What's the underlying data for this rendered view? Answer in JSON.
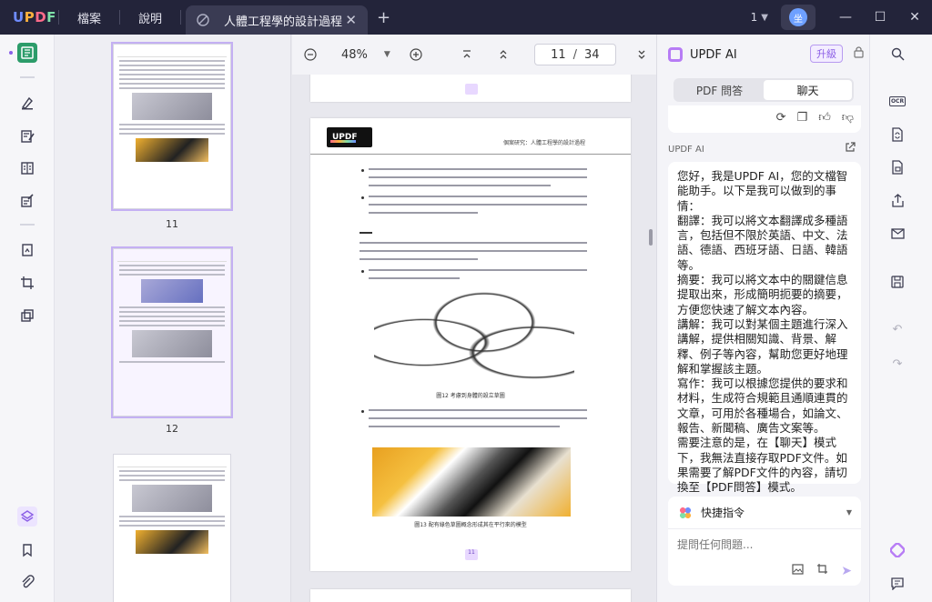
{
  "app": {
    "logo": {
      "u": "U",
      "p": "P",
      "d": "D",
      "f": "F"
    },
    "menus": [
      "檔案",
      "說明"
    ],
    "tab_title": "人體工程學的設計過程",
    "doc_count": "1",
    "avatar_initial": "坐"
  },
  "thumbnails": {
    "pages": [
      {
        "label": "11"
      },
      {
        "label": "12"
      }
    ]
  },
  "toolbar": {
    "zoom": "48%",
    "current_page": "11",
    "total_pages": "34"
  },
  "document": {
    "header_right": "個案研究：人體工程學的設計過程",
    "logo_text": "UPDF",
    "figure12_caption": "圖12 考慮到身體的設立草圖",
    "figure13_caption": "圖13 配有綠色草圖概念形成其在平行來的模型",
    "page_number": "11"
  },
  "ai": {
    "title": "UPDF AI",
    "upgrade": "升級",
    "mode_tabs": [
      "PDF 問答",
      "聊天"
    ],
    "active_mode": "聊天",
    "sender_label": "UPDF AI",
    "message": [
      "您好，我是UPDF AI，您的文檔智能助手。以下是我可以做到的事情：",
      "翻譯：我可以將文本翻譯成多種語言，包括但不限於英語、中文、法語、德語、西班牙語、日語、韓語等。",
      "摘要：我可以將文本中的關鍵信息提取出來，形成簡明扼要的摘要，方便您快速了解文本內容。",
      "講解：我可以對某個主題進行深入講解，提供相關知識、背景、解釋、例子等內容，幫助您更好地理解和掌握該主題。",
      "寫作：我可以根據您提供的要求和材料，生成符合規範且通順連貫的文章，可用於各種場合，如論文、報告、新聞稿、廣告文案等。",
      "需要注意的是，在【聊天】模式下，我無法直接存取PDF文件。如果需要了解PDF文件的內容，請切換至【PDF問答】模式。"
    ],
    "quick_commands": "快捷指令",
    "input_placeholder": "提問任何問題..."
  },
  "colors": {
    "titlebar": "#23243a",
    "accent_green": "#2c9c6a",
    "accent_purple": "#8c5fe6"
  }
}
